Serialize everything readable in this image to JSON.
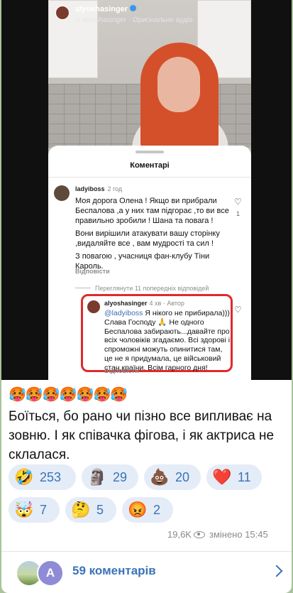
{
  "post": {
    "instagram": {
      "username": "alyoshasinger",
      "audio": "alyoshasinger · Оригінальне аудіо"
    },
    "comments_sheet": {
      "title": "Коментарі",
      "comment": {
        "user": "ladyiboss",
        "time": "2 год",
        "paragraphs": [
          "Моя дорога Олена ! Якщо ви прибрали Беспалова ,а у них там підгорає ,то ви все правильно зробили ! Шана та повага !",
          "Вони вирішили атакувати вашу сторінку ,видаляйте все , вам мудрості та сил !",
          "З повагою , учасниця фан-клубу Тіни Кароль."
        ],
        "likes": "1",
        "reply_label": "Відповісти"
      },
      "previous_replies": "Переглянути 11 попередніх відповідей",
      "author_reply": {
        "user": "alyoshasinger",
        "meta": "4 хв · Автор",
        "mention": "@ladyiboss",
        "text": " Я нікого не прибирала))) Слава Господу 🙏 Не одного Беспалова забирають...давайте про всіх чоловіків згадаємо. Всі здорові і спроможні можуть опинитися там, це не я придумала, це військовий стан країни. Всім гарного дня!",
        "reply_label": "Відповісти"
      }
    }
  },
  "message": {
    "emojis": "🥵🥵🥵🥵🥵🥵🥵",
    "text": "Боїться, бо рано чи пізно все випливає на зовню. І як співачка фігова, і як актриса не склалася."
  },
  "reactions": [
    {
      "emoji": "🤣",
      "count": "253"
    },
    {
      "emoji": "🗿",
      "count": "29"
    },
    {
      "emoji": "💩",
      "count": "20"
    },
    {
      "emoji": "❤️",
      "count": "11"
    },
    {
      "emoji": "🤯",
      "count": "7"
    },
    {
      "emoji": "🤔",
      "count": "5"
    },
    {
      "emoji": "😡",
      "count": "2"
    }
  ],
  "meta": {
    "views": "19,6K",
    "edited": "змінено 15:45"
  },
  "footer": {
    "avatar_letter": "A",
    "comments_label": "59 коментарів"
  },
  "colors": {
    "accent": "#3a73b8",
    "highlight_box": "#e02a2a",
    "reaction_chip": "#e4ecf7",
    "chat_background": "#a9c39a"
  }
}
